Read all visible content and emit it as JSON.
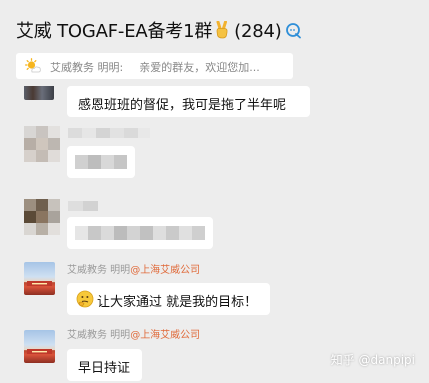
{
  "header": {
    "title": "艾威 TOGAF-EA备考1群",
    "member_count": "(284)"
  },
  "notice": {
    "sender": "艾威教务 明明:",
    "text": "亲爱的群友，欢迎您加..."
  },
  "messages": [
    {
      "bubble": "感恩班班的督促，我可是拖了半年呢"
    },
    {
      "sender": "艾威教务 明明",
      "org": "@上海艾威公司",
      "bubble": "让大家通过 就是我的目标！"
    },
    {
      "sender": "艾威教务 明明",
      "org": "@上海艾威公司",
      "bubble": "早日持证"
    }
  ],
  "watermark": "知乎 @danpipi",
  "colors": {
    "background": "#ededed",
    "bubble": "#ffffff",
    "org_tag": "#e06a3a"
  }
}
